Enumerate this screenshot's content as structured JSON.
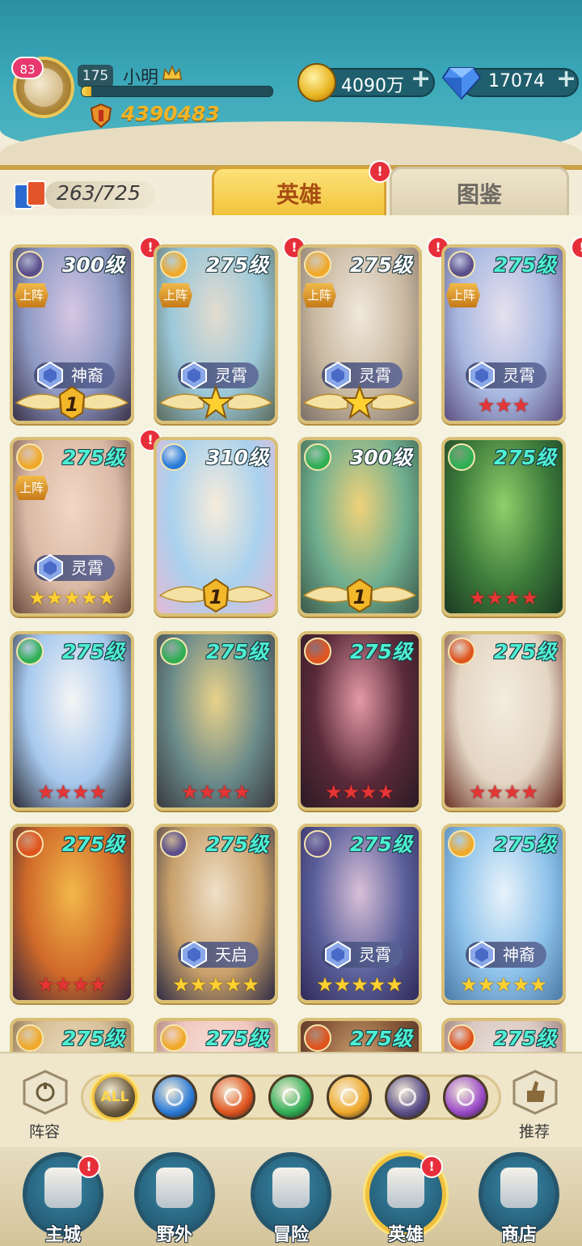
{
  "player": {
    "vip_badge": "83",
    "level": "175",
    "name": "小明",
    "exp_fraction": 0.05,
    "power": "4390483"
  },
  "resources": {
    "gold": "4090万",
    "diamonds": "17074"
  },
  "collection": {
    "count": "263/725"
  },
  "tabs": [
    {
      "label": "英雄",
      "active": true,
      "alert": "!"
    },
    {
      "label": "图鉴",
      "active": false
    }
  ],
  "heroes": [
    {
      "level": "300级",
      "level_color": "white",
      "faction": "shadow",
      "deployed": true,
      "deploy_label": "上阵",
      "rank_label": "神裔",
      "bottom": "wing",
      "wing_num": "1",
      "stars": 0,
      "star_color": "",
      "alert": true,
      "bg": [
        "#8f9ac4",
        "#d6c7e4",
        "#3a3148"
      ]
    },
    {
      "level": "275级",
      "level_color": "white",
      "faction": "light",
      "deployed": true,
      "deploy_label": "上阵",
      "rank_label": "灵霄",
      "bottom": "wing-star",
      "wing_num": "",
      "stars": 0,
      "star_color": "",
      "alert": true,
      "bg": [
        "#9bc7d8",
        "#e3dcd0",
        "#5a6b5c"
      ]
    },
    {
      "level": "275级",
      "level_color": "white",
      "faction": "light",
      "deployed": true,
      "deploy_label": "上阵",
      "rank_label": "灵霄",
      "bottom": "wing-star",
      "wing_num": "",
      "stars": 0,
      "star_color": "",
      "alert": true,
      "bg": [
        "#c8b8a0",
        "#f1e8dc",
        "#7b6e66"
      ]
    },
    {
      "level": "275级",
      "level_color": "teal",
      "faction": "shadow",
      "deployed": true,
      "deploy_label": "上阵",
      "rank_label": "灵霄",
      "bottom": "stars",
      "wing_num": "",
      "stars": 3,
      "star_color": "red",
      "alert": true,
      "bg": [
        "#a8b8e0",
        "#e6e0ee",
        "#5d5080"
      ]
    },
    {
      "level": "275级",
      "level_color": "teal",
      "faction": "light",
      "deployed": true,
      "deploy_label": "上阵",
      "rank_label": "灵霄",
      "bottom": "stars",
      "wing_num": "",
      "stars": 5,
      "star_color": "gold",
      "alert": true,
      "bg": [
        "#d9b9a6",
        "#f2d8c4",
        "#6b4a3c"
      ]
    },
    {
      "level": "310级",
      "level_color": "white",
      "faction": "water",
      "deployed": false,
      "deploy_label": "",
      "rank_label": "",
      "bottom": "wing",
      "wing_num": "1",
      "stars": 0,
      "star_color": "",
      "alert": false,
      "bg": [
        "#a9d1ee",
        "#f7ecda",
        "#e3b9d4"
      ]
    },
    {
      "level": "300级",
      "level_color": "white",
      "faction": "wind",
      "deployed": false,
      "deploy_label": "",
      "rank_label": "",
      "bottom": "wing",
      "wing_num": "1",
      "stars": 0,
      "star_color": "",
      "alert": false,
      "bg": [
        "#6fae8f",
        "#f0d27a",
        "#3d5a4a"
      ]
    },
    {
      "level": "275级",
      "level_color": "teal",
      "faction": "wind",
      "deployed": false,
      "deploy_label": "",
      "rank_label": "",
      "bottom": "stars",
      "wing_num": "",
      "stars": 4,
      "star_color": "red",
      "alert": false,
      "bg": [
        "#3c7a3a",
        "#8fd06a",
        "#1b3a22"
      ]
    },
    {
      "level": "275级",
      "level_color": "teal",
      "faction": "wind",
      "deployed": false,
      "deploy_label": "",
      "rank_label": "",
      "bottom": "stars",
      "wing_num": "",
      "stars": 4,
      "star_color": "red",
      "alert": false,
      "bg": [
        "#a7c9ee",
        "#f5f5f5",
        "#2a2a34"
      ]
    },
    {
      "level": "275级",
      "level_color": "teal",
      "faction": "wind",
      "deployed": false,
      "deploy_label": "",
      "rank_label": "",
      "bottom": "stars",
      "wing_num": "",
      "stars": 4,
      "star_color": "red",
      "alert": false,
      "bg": [
        "#6a8a8a",
        "#e9d28a",
        "#3a3a3e"
      ]
    },
    {
      "level": "275级",
      "level_color": "teal",
      "faction": "fire",
      "deployed": false,
      "deploy_label": "",
      "rank_label": "",
      "bottom": "stars",
      "wing_num": "",
      "stars": 4,
      "star_color": "red",
      "alert": false,
      "bg": [
        "#5a2a3a",
        "#e59aa6",
        "#2a1a22"
      ]
    },
    {
      "level": "275级",
      "level_color": "teal",
      "faction": "fire",
      "deployed": false,
      "deploy_label": "",
      "rank_label": "",
      "bottom": "stars",
      "wing_num": "",
      "stars": 4,
      "star_color": "red",
      "alert": false,
      "bg": [
        "#e4d6c4",
        "#f4ecdf",
        "#6a3024"
      ]
    },
    {
      "level": "275级",
      "level_color": "teal",
      "faction": "fire",
      "deployed": false,
      "deploy_label": "",
      "rank_label": "",
      "bottom": "stars",
      "wing_num": "",
      "stars": 4,
      "star_color": "red",
      "alert": false,
      "bg": [
        "#d06a2a",
        "#f2b84a",
        "#3a2638"
      ]
    },
    {
      "level": "275级",
      "level_color": "teal",
      "faction": "shadow",
      "deployed": false,
      "deploy_label": "",
      "rank_label": "天启",
      "bottom": "stars",
      "wing_num": "",
      "stars": 5,
      "star_color": "gold",
      "alert": false,
      "bg": [
        "#c8a06a",
        "#efe0c8",
        "#2c2a44"
      ]
    },
    {
      "level": "275级",
      "level_color": "teal",
      "faction": "shadow",
      "deployed": false,
      "deploy_label": "",
      "rank_label": "灵霄",
      "bottom": "stars",
      "wing_num": "",
      "stars": 5,
      "star_color": "gold",
      "alert": false,
      "bg": [
        "#5a5f9a",
        "#d9c0d8",
        "#302a58"
      ]
    },
    {
      "level": "275级",
      "level_color": "teal",
      "faction": "light",
      "deployed": false,
      "deploy_label": "",
      "rank_label": "神裔",
      "bottom": "stars",
      "wing_num": "",
      "stars": 5,
      "star_color": "gold",
      "alert": false,
      "bg": [
        "#8ec2ea",
        "#e8f3fb",
        "#4a7aa6"
      ]
    },
    {
      "level": "275级",
      "level_color": "teal",
      "faction": "light",
      "deployed": false,
      "deploy_label": "",
      "rank_label": "",
      "bottom": "none",
      "wing_num": "",
      "stars": 0,
      "star_color": "",
      "alert": false,
      "bg": [
        "#d7c098",
        "#efe2c8",
        "#7a5a3a"
      ]
    },
    {
      "level": "275级",
      "level_color": "teal",
      "faction": "light",
      "deployed": false,
      "deploy_label": "",
      "rank_label": "",
      "bottom": "none",
      "wing_num": "",
      "stars": 0,
      "star_color": "",
      "alert": false,
      "bg": [
        "#f0c8c0",
        "#f7e8e0",
        "#9a6a6a"
      ]
    },
    {
      "level": "275级",
      "level_color": "teal",
      "faction": "fire",
      "deployed": false,
      "deploy_label": "",
      "rank_label": "",
      "bottom": "none",
      "wing_num": "",
      "stars": 0,
      "star_color": "",
      "alert": false,
      "bg": [
        "#8a5a3a",
        "#e9c08a",
        "#4a2a22"
      ]
    },
    {
      "level": "275级",
      "level_color": "teal",
      "faction": "fire",
      "deployed": false,
      "deploy_label": "",
      "rank_label": "",
      "bottom": "none",
      "wing_num": "",
      "stars": 0,
      "star_color": "",
      "alert": false,
      "bg": [
        "#d8c8c0",
        "#f5ede8",
        "#8a6a6a"
      ]
    }
  ],
  "filters": {
    "left_label": "阵容",
    "right_label": "推荐",
    "all_label": "ALL",
    "factions": [
      {
        "name": "all",
        "color": "#6b5a3a"
      },
      {
        "name": "water",
        "color": "#2a7ad8"
      },
      {
        "name": "fire",
        "color": "#e0541e"
      },
      {
        "name": "wind",
        "color": "#2fae54"
      },
      {
        "name": "light",
        "color": "#f0a92a"
      },
      {
        "name": "shadow",
        "color": "#5a4e8a"
      },
      {
        "name": "arcane",
        "color": "#9a4ac8"
      }
    ]
  },
  "nav": [
    {
      "label": "主城",
      "icon": "castle-icon",
      "alert": true,
      "active": false
    },
    {
      "label": "野外",
      "icon": "portal-icon",
      "alert": false,
      "active": false
    },
    {
      "label": "冒险",
      "icon": "sword-icon",
      "alert": false,
      "active": false
    },
    {
      "label": "英雄",
      "icon": "knight-helmet-icon",
      "alert": true,
      "active": true
    },
    {
      "label": "商店",
      "icon": "shop-icon",
      "alert": false,
      "active": false
    }
  ],
  "colors": {
    "shadow": "#5a4e8a",
    "light": "#f0a92a",
    "water": "#2a7ad8",
    "wind": "#2fae54",
    "fire": "#e0541e",
    "arcane": "#9a4ac8"
  }
}
